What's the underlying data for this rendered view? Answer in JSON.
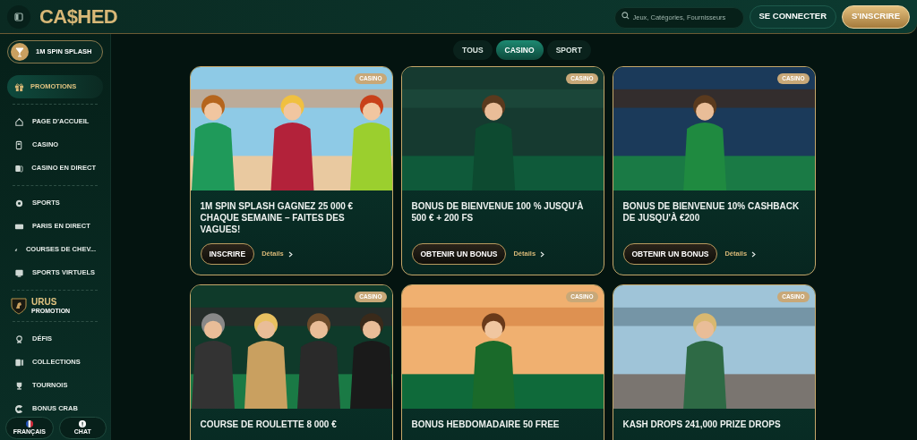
{
  "header": {
    "logo": "CA$HED",
    "search": {
      "placeholder": "Jeux, Catégories, Fournisseurs"
    },
    "buttons": [
      {
        "label": "SE CONNECTER",
        "kind": "secondary"
      },
      {
        "label": "S'INSCRIRE",
        "kind": "primary"
      }
    ]
  },
  "filter_tabs": [
    {
      "label": "TOUS",
      "selected": false
    },
    {
      "label": "CASINO",
      "selected": true
    },
    {
      "label": "SPORT",
      "selected": false
    }
  ],
  "sidebar": {
    "highlights": [
      {
        "label": "1M SPIN SPLASH",
        "kind": "spin"
      },
      {
        "label": "PROMOTIONS",
        "kind": "promo"
      }
    ],
    "groups": [
      [
        {
          "label": "PAGE D'ACCUEIL"
        },
        {
          "label": "CASINO"
        },
        {
          "label": "CASINO EN DIRECT"
        }
      ],
      [
        {
          "label": "SPORTS"
        },
        {
          "label": "PARIS EN DIRECT"
        },
        {
          "label": "COURSES DE CHEV..."
        },
        {
          "label": "SPORTS VIRTUELS"
        }
      ]
    ],
    "urus": {
      "title": "URUS",
      "subtitle": "PROMOTION"
    },
    "more": [
      {
        "label": "DÉFIS"
      },
      {
        "label": "COLLECTIONS"
      },
      {
        "label": "TOURNOIS"
      },
      {
        "label": "BONUS CRAB"
      }
    ],
    "footer": [
      {
        "label": "FRANÇAIS",
        "kind": "language"
      },
      {
        "label": "CHAT",
        "kind": "chat"
      }
    ]
  },
  "cards": [
    {
      "badge": "CASINO",
      "title": "1M SPIN SPLASH GAGNEZ 25 000 € CHAQUE SEMAINE – FAITES DES VAGUES!",
      "button": "INSCRIRE",
      "link": "Détails"
    },
    {
      "badge": "CASINO",
      "title": "BONUS DE BIENVENUE 100 % JUSQU'À 500 € + 200 FS",
      "button": "OBTENIR UN BONUS",
      "link": "Détails"
    },
    {
      "badge": "CASINO",
      "title": "BONUS DE BIENVENUE 10% CASHBACK DE JUSQU'À €200",
      "button": "OBTENIR UN BONUS",
      "link": "Détails"
    },
    {
      "badge": "CASINO",
      "title": "COURSE DE ROULETTE 8 000 €"
    },
    {
      "badge": "CASINO",
      "title": "BONUS HEBDOMADAIRE 50 FREE"
    },
    {
      "badge": "CASINO",
      "title": "KASH DROPS 241,000 PRIZE DROPS"
    }
  ]
}
